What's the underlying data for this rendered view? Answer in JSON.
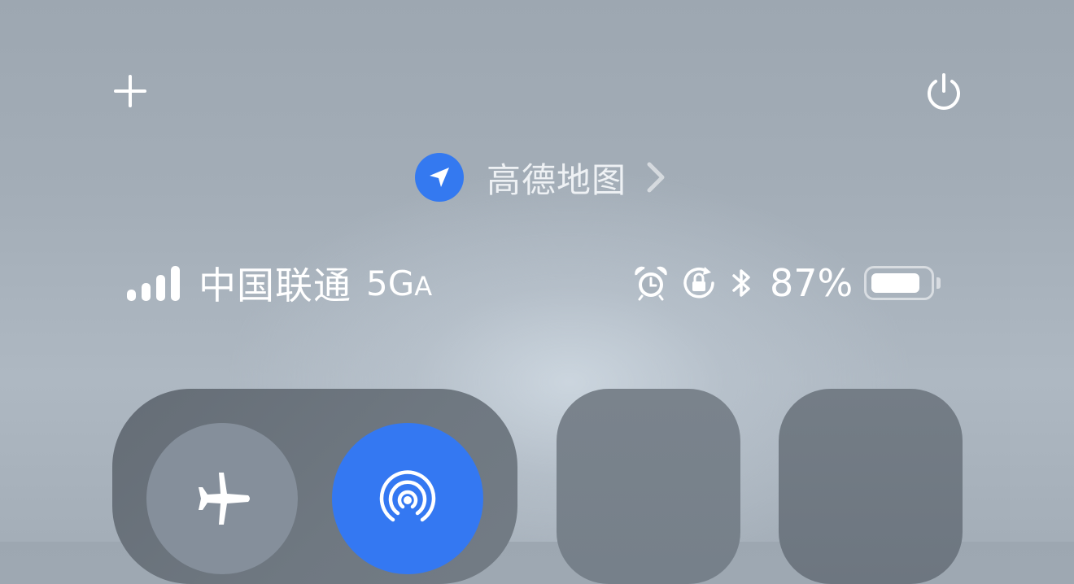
{
  "top_bar": {
    "add_icon": "plus-icon",
    "power_icon": "power-icon"
  },
  "location": {
    "icon": "location-arrow-icon",
    "app_name": "高德地图",
    "chevron_icon": "chevron-right-icon",
    "accent": "#3479f0"
  },
  "status": {
    "signal_bars": 4,
    "carrier": "中国联通",
    "network_main": "5G",
    "network_suffix": "A",
    "alarm_icon": "alarm-icon",
    "rotation_lock_icon": "rotation-lock-icon",
    "bluetooth_icon": "bluetooth-icon",
    "battery_percent": "87%",
    "battery_level": 0.87
  },
  "controls": {
    "airplane_icon": "airplane-icon",
    "airdrop_icon": "airdrop-icon",
    "airdrop_active_color": "#3478f2"
  }
}
